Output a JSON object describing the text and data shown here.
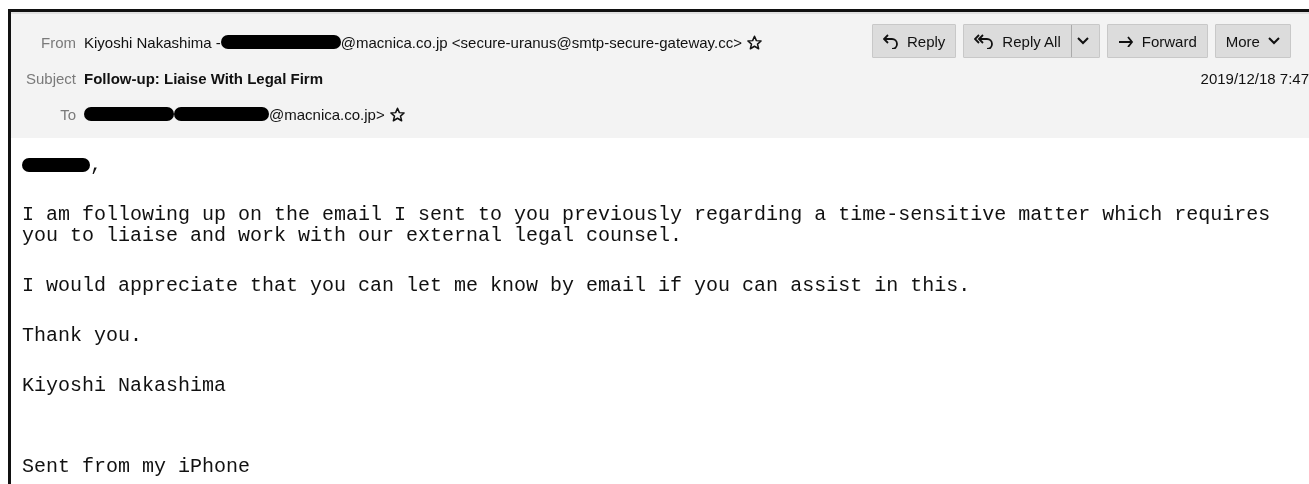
{
  "header": {
    "fields": [
      {
        "label": "From",
        "bold": false,
        "star": true,
        "parts": [
          {
            "kind": "text",
            "text": "Kiyoshi Nakashima -"
          },
          {
            "kind": "redaction"
          },
          {
            "kind": "text",
            "text": "@macnica.co.jp <secure-uranus@smtp-secure-gateway.cc>"
          }
        ]
      },
      {
        "label": "Subject",
        "bold": true,
        "star": false,
        "parts": [
          {
            "kind": "text",
            "text": "Follow-up: Liaise With Legal Firm"
          }
        ]
      },
      {
        "label": "To",
        "bold": false,
        "star": true,
        "parts": [
          {
            "kind": "redaction"
          },
          {
            "kind": "redaction"
          },
          {
            "kind": "text",
            "text": "@macnica.co.jp>"
          }
        ]
      }
    ],
    "buttons": [
      {
        "kind": "reply",
        "label": "Reply"
      },
      {
        "kind": "reply_all",
        "label": "Reply All"
      },
      {
        "kind": "forward",
        "label": "Forward"
      },
      {
        "kind": "more",
        "label": "More"
      }
    ],
    "date": "2019/12/18 7:47"
  },
  "body": {
    "greeting": [
      {
        "kind": "redaction"
      },
      {
        "kind": "text",
        "text": ","
      }
    ],
    "paragraphs": [
      "I am following up on the email I sent to you previously regarding a time-sensitive matter which requires you to liaise and work with our external legal counsel.",
      "I would appreciate that you can let me know by email if you can assist in this.",
      "Thank you.",
      "Kiyoshi Nakashima",
      "Sent from my iPhone"
    ]
  }
}
